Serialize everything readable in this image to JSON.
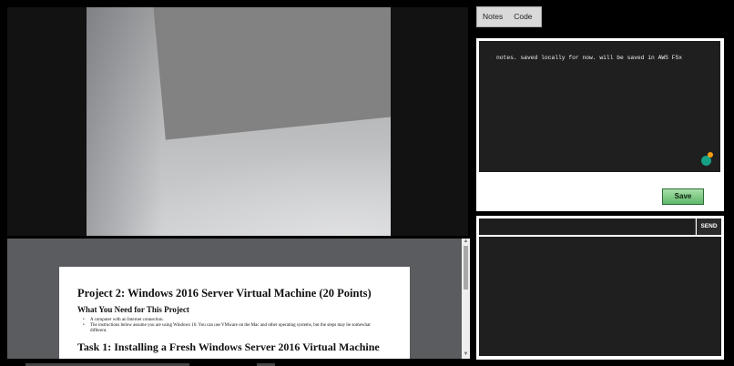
{
  "tabs": [
    {
      "label": "Notes"
    },
    {
      "label": "Code"
    }
  ],
  "notes": {
    "text": "notes. saved locally for now. will be saved in AWS FSx",
    "save_label": "Save"
  },
  "chat": {
    "input_value": "",
    "send_label": "SEND"
  },
  "document": {
    "title": "Project 2: Windows 2016 Server Virtual Machine (20 Points)",
    "subheading": "What You Need for This Project",
    "bullets": [
      "A computer with an Internet connection.",
      "The instructions below assume you are using Windows 10. You can use VMware on the Mac and other operating systems, but the steps may be somewhat different."
    ],
    "task_heading": "Task 1: Installing a Fresh Windows Server 2016 Virtual Machine"
  },
  "colors": {
    "save_button": "#5fb76a",
    "editor_bg": "#1f1f1f",
    "doc_viewer_bg": "#5a5c5f"
  }
}
